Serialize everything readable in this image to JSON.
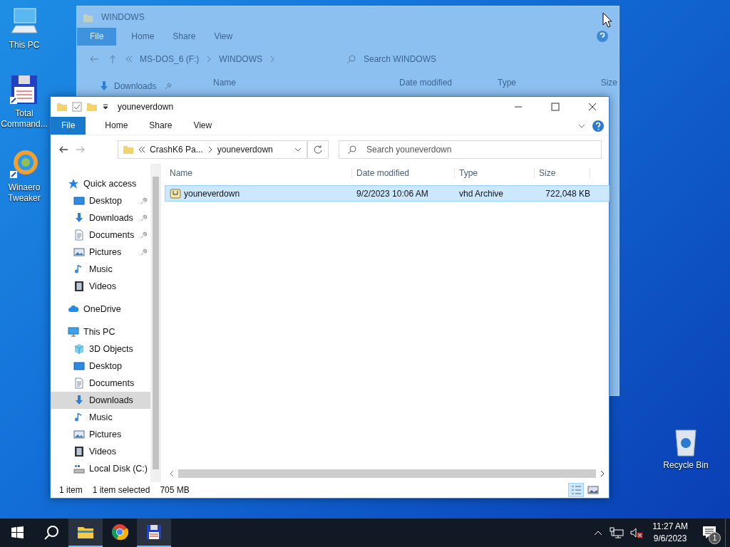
{
  "desktop_icons": [
    {
      "label": "This PC",
      "kind": "pc"
    },
    {
      "label": "Total Command...",
      "kind": "floppy"
    },
    {
      "label": "Winaero Tweaker",
      "kind": "swirl"
    },
    {
      "label": "Recycle Bin",
      "kind": "bin"
    }
  ],
  "ghost_window": {
    "title": "WINDOWS",
    "ribbon": [
      {
        "label": "File",
        "kind": "menu"
      },
      {
        "label": "Home",
        "kind": "tab"
      },
      {
        "label": "Share",
        "kind": "tab"
      },
      {
        "label": "View",
        "kind": "tab"
      }
    ],
    "path": [
      "MS-DOS_6 (F:)",
      "WINDOWS"
    ],
    "search": {
      "placeholder": "Search WINDOWS"
    },
    "nav": [
      {
        "label": "Downloads",
        "kind": "download",
        "pinned": true
      }
    ],
    "columns": [
      "Name",
      "Date modified",
      "Type",
      "Size"
    ]
  },
  "window": {
    "title": "youneverdown",
    "ribbon": [
      {
        "label": "File",
        "kind": "menu"
      },
      {
        "label": "Home",
        "kind": "tab"
      },
      {
        "label": "Share",
        "kind": "tab"
      },
      {
        "label": "View",
        "kind": "tab"
      }
    ],
    "path": [
      "CrashK6 Pa...",
      "youneverdown"
    ],
    "search": {
      "placeholder": "Search youneverdown"
    },
    "nav": [
      {
        "label": "Quick access",
        "kind": "star",
        "pinned": false,
        "selected": false,
        "group": true
      },
      {
        "label": "Desktop",
        "kind": "desktop",
        "pinned": true,
        "selected": false,
        "group": false
      },
      {
        "label": "Downloads",
        "kind": "download",
        "pinned": true,
        "selected": false,
        "group": false
      },
      {
        "label": "Documents",
        "kind": "document",
        "pinned": true,
        "selected": false,
        "group": false
      },
      {
        "label": "Pictures",
        "kind": "picture",
        "pinned": true,
        "selected": false,
        "group": false
      },
      {
        "label": "Music",
        "kind": "music",
        "pinned": false,
        "selected": false,
        "group": false
      },
      {
        "label": "Videos",
        "kind": "video",
        "pinned": false,
        "selected": false,
        "group": false
      },
      {
        "label": "OneDrive",
        "kind": "cloud",
        "pinned": false,
        "selected": false,
        "group": true
      },
      {
        "label": "This PC",
        "kind": "pc",
        "pinned": false,
        "selected": false,
        "group": true
      },
      {
        "label": "3D Objects",
        "kind": "cube",
        "pinned": false,
        "selected": false,
        "group": false
      },
      {
        "label": "Desktop",
        "kind": "desktop",
        "pinned": false,
        "selected": false,
        "group": false
      },
      {
        "label": "Documents",
        "kind": "document",
        "pinned": false,
        "selected": false,
        "group": false
      },
      {
        "label": "Downloads",
        "kind": "download",
        "pinned": false,
        "selected": true,
        "group": false
      },
      {
        "label": "Music",
        "kind": "music",
        "pinned": false,
        "selected": false,
        "group": false
      },
      {
        "label": "Pictures",
        "kind": "picture",
        "pinned": false,
        "selected": false,
        "group": false
      },
      {
        "label": "Videos",
        "kind": "video",
        "pinned": false,
        "selected": false,
        "group": false
      },
      {
        "label": "Local Disk (C:)",
        "kind": "drive",
        "pinned": false,
        "selected": false,
        "group": false
      }
    ],
    "columns": [
      "Name",
      "Date modified",
      "Type",
      "Size"
    ],
    "rows": [
      {
        "name": "youneverdown",
        "kind": "vhd",
        "date": "9/2/2023 10:06 AM",
        "type": "vhd Archive",
        "size": "722,048 KB",
        "selected": true
      }
    ],
    "status": [
      "1 item",
      "1 item selected",
      "705 MB"
    ]
  },
  "taskbar": {
    "apps": [
      {
        "kind": "explorer",
        "running": true
      },
      {
        "kind": "chrome",
        "running": false
      },
      {
        "kind": "floppy",
        "running": true
      }
    ],
    "time": "11:27 AM",
    "date": "9/6/2023",
    "notifications": "1"
  }
}
